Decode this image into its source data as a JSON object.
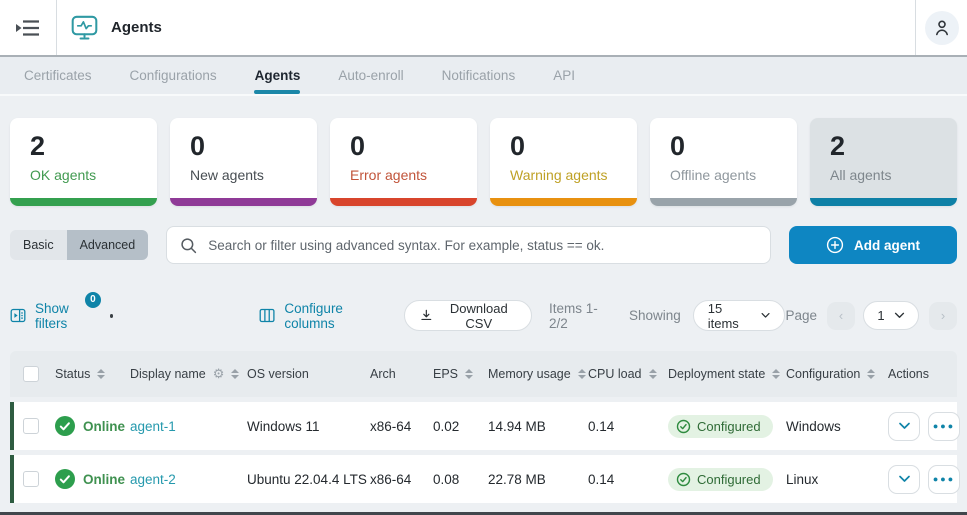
{
  "topbar": {
    "title": "Agents"
  },
  "tabs": {
    "items": [
      {
        "label": "Certificates"
      },
      {
        "label": "Configurations"
      },
      {
        "label": "Agents"
      },
      {
        "label": "Auto-enroll"
      },
      {
        "label": "Notifications"
      },
      {
        "label": "API"
      }
    ]
  },
  "summary_cards": [
    {
      "value": "2",
      "label": "OK agents",
      "label_color": "#419a50",
      "bar_color": "#34a04f"
    },
    {
      "value": "0",
      "label": "New agents",
      "label_color": "#474d52",
      "bar_color": "#8f3a97"
    },
    {
      "value": "0",
      "label": "Error agents",
      "label_color": "#c1543a",
      "bar_color": "#d8452c"
    },
    {
      "value": "0",
      "label": "Warning agents",
      "label_color": "#bfa125",
      "bar_color": "#e89110"
    },
    {
      "value": "0",
      "label": "Offline agents",
      "label_color": "#8f979d",
      "bar_color": "#99a3aa"
    },
    {
      "value": "2",
      "label": "All agents",
      "label_color": "#7e868c",
      "bar_color": "#0e80a6"
    }
  ],
  "filter_bar": {
    "basic": "Basic",
    "advanced": "Advanced",
    "search_placeholder": "Search or filter using advanced syntax. For example, status == ok.",
    "add_agent": "Add agent",
    "add_agent_color": "#0e86c2"
  },
  "toolbar": {
    "show_filters": "Show filters",
    "filters_badge": "0",
    "configure_columns": "Configure columns",
    "download_csv": "Download CSV",
    "items_range": "Items 1-2/2",
    "showing": "Showing",
    "page_size": "15 items",
    "page": "Page",
    "page_number": "1",
    "prev": "‹",
    "next": "›"
  },
  "table": {
    "columns": {
      "status": "Status",
      "display_name": "Display name",
      "os_version": "OS version",
      "arch": "Arch",
      "eps": "EPS",
      "memory_usage": "Memory usage",
      "cpu_load": "CPU load",
      "deployment_state": "Deployment state",
      "configuration": "Configuration",
      "actions": "Actions"
    },
    "rows": [
      {
        "status": "Online",
        "display_name": "agent-1",
        "os_version": "Windows 11",
        "arch": "x86-64",
        "eps": "0.02",
        "memory_usage": "14.94 MB",
        "cpu_load": "0.14",
        "deployment_state": "Configured",
        "configuration": "Windows"
      },
      {
        "status": "Online",
        "display_name": "agent-2",
        "os_version": "Ubuntu 22.04.4 LTS",
        "arch": "x86-64",
        "eps": "0.08",
        "memory_usage": "22.78 MB",
        "cpu_load": "0.14",
        "deployment_state": "Configured",
        "configuration": "Linux"
      }
    ]
  },
  "colors": {
    "accent_teal": "#0f84a8",
    "online_green": "#3f9150",
    "row_status_bar": "#2e5c41"
  }
}
